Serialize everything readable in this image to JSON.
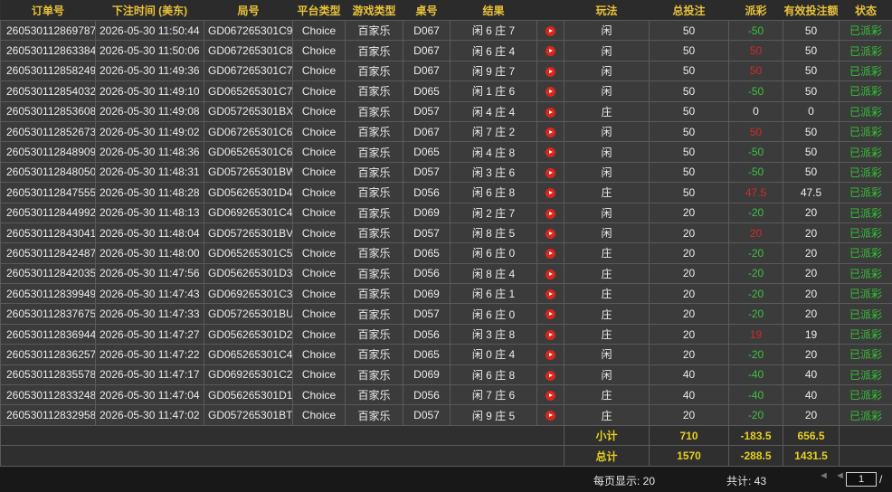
{
  "columns": [
    "订单号",
    "下注时间 (美东)",
    "局号",
    "平台类型",
    "游戏类型",
    "桌号",
    "结果",
    "",
    "玩法",
    "总投注",
    "派彩",
    "有效投注额",
    "状态"
  ],
  "rows": [
    {
      "order": "260530112869787",
      "time": "2026-05-30 11:50:44",
      "round": "GD067265301C9",
      "platform": "Choice",
      "game": "百家乐",
      "table": "D067",
      "result": "闲 6 庄 7",
      "play": "闲",
      "bet": "50",
      "payout": "-50",
      "payout_color": "pos",
      "valid": "50",
      "status": "已派彩"
    },
    {
      "order": "260530112863384",
      "time": "2026-05-30 11:50:06",
      "round": "GD067265301C8",
      "platform": "Choice",
      "game": "百家乐",
      "table": "D067",
      "result": "闲 6 庄 4",
      "play": "闲",
      "bet": "50",
      "payout": "50",
      "payout_color": "neg",
      "valid": "50",
      "status": "已派彩"
    },
    {
      "order": "260530112858249",
      "time": "2026-05-30 11:49:36",
      "round": "GD067265301C7",
      "platform": "Choice",
      "game": "百家乐",
      "table": "D067",
      "result": "闲 9 庄 7",
      "play": "闲",
      "bet": "50",
      "payout": "50",
      "payout_color": "neg",
      "valid": "50",
      "status": "已派彩"
    },
    {
      "order": "260530112854032",
      "time": "2026-05-30 11:49:10",
      "round": "GD065265301C7",
      "platform": "Choice",
      "game": "百家乐",
      "table": "D065",
      "result": "闲 1 庄 6",
      "play": "闲",
      "bet": "50",
      "payout": "-50",
      "payout_color": "pos",
      "valid": "50",
      "status": "已派彩"
    },
    {
      "order": "260530112853608",
      "time": "2026-05-30 11:49:08",
      "round": "GD057265301BX",
      "platform": "Choice",
      "game": "百家乐",
      "table": "D057",
      "result": "闲 4 庄 4",
      "play": "庄",
      "bet": "50",
      "payout": "0",
      "payout_color": "zero",
      "valid": "0",
      "status": "已派彩"
    },
    {
      "order": "260530112852673",
      "time": "2026-05-30 11:49:02",
      "round": "GD067265301C6",
      "platform": "Choice",
      "game": "百家乐",
      "table": "D067",
      "result": "闲 7 庄 2",
      "play": "闲",
      "bet": "50",
      "payout": "50",
      "payout_color": "neg",
      "valid": "50",
      "status": "已派彩"
    },
    {
      "order": "260530112848909",
      "time": "2026-05-30 11:48:36",
      "round": "GD065265301C6",
      "platform": "Choice",
      "game": "百家乐",
      "table": "D065",
      "result": "闲 4 庄 8",
      "play": "闲",
      "bet": "50",
      "payout": "-50",
      "payout_color": "pos",
      "valid": "50",
      "status": "已派彩"
    },
    {
      "order": "260530112848050",
      "time": "2026-05-30 11:48:31",
      "round": "GD057265301BW",
      "platform": "Choice",
      "game": "百家乐",
      "table": "D057",
      "result": "闲 3 庄 6",
      "play": "闲",
      "bet": "50",
      "payout": "-50",
      "payout_color": "pos",
      "valid": "50",
      "status": "已派彩"
    },
    {
      "order": "260530112847555",
      "time": "2026-05-30 11:48:28",
      "round": "GD056265301D4",
      "platform": "Choice",
      "game": "百家乐",
      "table": "D056",
      "result": "闲 6 庄 8",
      "play": "庄",
      "bet": "50",
      "payout": "47.5",
      "payout_color": "neg",
      "valid": "47.5",
      "status": "已派彩"
    },
    {
      "order": "260530112844992",
      "time": "2026-05-30 11:48:13",
      "round": "GD069265301C4",
      "platform": "Choice",
      "game": "百家乐",
      "table": "D069",
      "result": "闲 2 庄 7",
      "play": "闲",
      "bet": "20",
      "payout": "-20",
      "payout_color": "pos",
      "valid": "20",
      "status": "已派彩"
    },
    {
      "order": "260530112843041",
      "time": "2026-05-30 11:48:04",
      "round": "GD057265301BV",
      "platform": "Choice",
      "game": "百家乐",
      "table": "D057",
      "result": "闲 8 庄 5",
      "play": "闲",
      "bet": "20",
      "payout": "20",
      "payout_color": "neg",
      "valid": "20",
      "status": "已派彩"
    },
    {
      "order": "260530112842487",
      "time": "2026-05-30 11:48:00",
      "round": "GD065265301C5",
      "platform": "Choice",
      "game": "百家乐",
      "table": "D065",
      "result": "闲 6 庄 0",
      "play": "庄",
      "bet": "20",
      "payout": "-20",
      "payout_color": "pos",
      "valid": "20",
      "status": "已派彩"
    },
    {
      "order": "260530112842035",
      "time": "2026-05-30 11:47:56",
      "round": "GD056265301D3",
      "platform": "Choice",
      "game": "百家乐",
      "table": "D056",
      "result": "闲 8 庄 4",
      "play": "庄",
      "bet": "20",
      "payout": "-20",
      "payout_color": "pos",
      "valid": "20",
      "status": "已派彩"
    },
    {
      "order": "260530112839949",
      "time": "2026-05-30 11:47:43",
      "round": "GD069265301C3",
      "platform": "Choice",
      "game": "百家乐",
      "table": "D069",
      "result": "闲 6 庄 1",
      "play": "庄",
      "bet": "20",
      "payout": "-20",
      "payout_color": "pos",
      "valid": "20",
      "status": "已派彩"
    },
    {
      "order": "260530112837675",
      "time": "2026-05-30 11:47:33",
      "round": "GD057265301BU",
      "platform": "Choice",
      "game": "百家乐",
      "table": "D057",
      "result": "闲 6 庄 0",
      "play": "庄",
      "bet": "20",
      "payout": "-20",
      "payout_color": "pos",
      "valid": "20",
      "status": "已派彩"
    },
    {
      "order": "260530112836944",
      "time": "2026-05-30 11:47:27",
      "round": "GD056265301D2",
      "platform": "Choice",
      "game": "百家乐",
      "table": "D056",
      "result": "闲 3 庄 8",
      "play": "庄",
      "bet": "20",
      "payout": "19",
      "payout_color": "neg",
      "valid": "19",
      "status": "已派彩"
    },
    {
      "order": "260530112836257",
      "time": "2026-05-30 11:47:22",
      "round": "GD065265301C4",
      "platform": "Choice",
      "game": "百家乐",
      "table": "D065",
      "result": "闲 0 庄 4",
      "play": "闲",
      "bet": "20",
      "payout": "-20",
      "payout_color": "pos",
      "valid": "20",
      "status": "已派彩"
    },
    {
      "order": "260530112835578",
      "time": "2026-05-30 11:47:17",
      "round": "GD069265301C2",
      "platform": "Choice",
      "game": "百家乐",
      "table": "D069",
      "result": "闲 6 庄 8",
      "play": "闲",
      "bet": "40",
      "payout": "-40",
      "payout_color": "pos",
      "valid": "40",
      "status": "已派彩"
    },
    {
      "order": "260530112833248",
      "time": "2026-05-30 11:47:04",
      "round": "GD056265301D1",
      "platform": "Choice",
      "game": "百家乐",
      "table": "D056",
      "result": "闲 7 庄 6",
      "play": "庄",
      "bet": "40",
      "payout": "-40",
      "payout_color": "pos",
      "valid": "40",
      "status": "已派彩"
    },
    {
      "order": "260530112832958",
      "time": "2026-05-30 11:47:02",
      "round": "GD057265301BT",
      "platform": "Choice",
      "game": "百家乐",
      "table": "D057",
      "result": "闲 9 庄 5",
      "play": "庄",
      "bet": "20",
      "payout": "-20",
      "payout_color": "pos",
      "valid": "20",
      "status": "已派彩"
    }
  ],
  "subtotal": {
    "label": "小计",
    "bet": "710",
    "payout": "-183.5",
    "valid": "656.5"
  },
  "grandtotal": {
    "label": "总计",
    "bet": "1570",
    "payout": "-288.5",
    "valid": "1431.5"
  },
  "footer": {
    "per_page": "每页显示: 20",
    "total": "共计: 43",
    "page_value": "1",
    "slash": "/",
    "first_glyph": "◄",
    "prev_glyph": "◄"
  },
  "colors": {
    "header": "#e8c23a",
    "positive": "#3ec13e",
    "negative": "#d42a2a",
    "summary": "#e8d020",
    "paid": "#35c335"
  },
  "icons": {
    "result_detail": "play-icon"
  }
}
